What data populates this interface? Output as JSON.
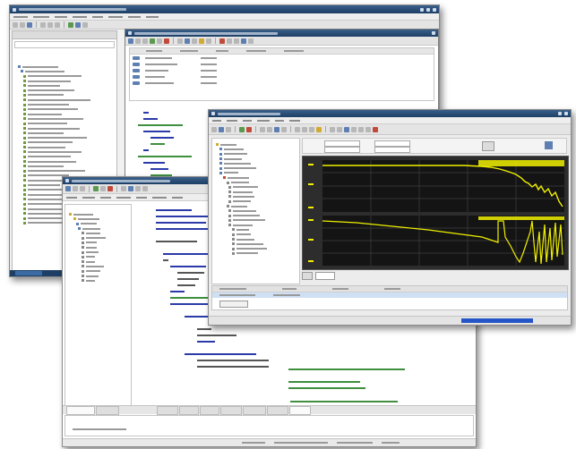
{
  "background": "#ffffff",
  "windows": {
    "back": {
      "accent": "#1d3f66",
      "tree_icon_color": "#3a9e3a",
      "tree_items": 34
    },
    "code": {
      "keyword_color": "#2b3aa8",
      "comment_color": "#3f8f3f"
    },
    "scope": {
      "trace_color": "#f0f000",
      "plot_bg": "#141414",
      "grid_color": "#4a4a4a"
    }
  }
}
